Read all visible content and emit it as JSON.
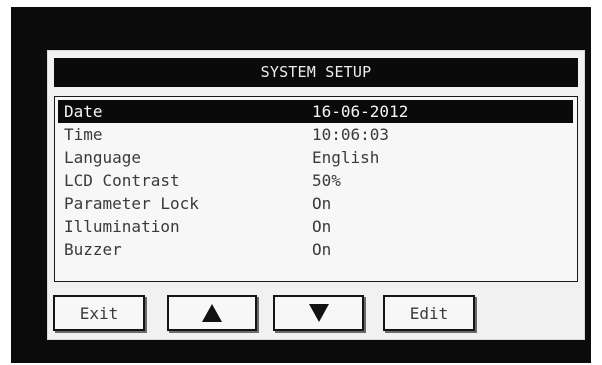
{
  "screen": {
    "title": "SYSTEM SETUP"
  },
  "settings": [
    {
      "label": "Date",
      "value": "16-06-2012",
      "selected": true
    },
    {
      "label": "Time",
      "value": "10:06:03"
    },
    {
      "label": "Language",
      "value": "English"
    },
    {
      "label": "LCD Contrast",
      "value": "50%"
    },
    {
      "label": "Parameter Lock",
      "value": "On"
    },
    {
      "label": "Illumination",
      "value": "On"
    },
    {
      "label": "Buzzer",
      "value": "On"
    }
  ],
  "buttons": {
    "exit_label": "Exit",
    "up_icon": "arrow-up-icon",
    "down_icon": "arrow-down-icon",
    "edit_label": "Edit"
  },
  "colors": {
    "bezel": "#0b0b0b",
    "screen": "#f1f1f1",
    "highlight": "#0a0a0a"
  }
}
